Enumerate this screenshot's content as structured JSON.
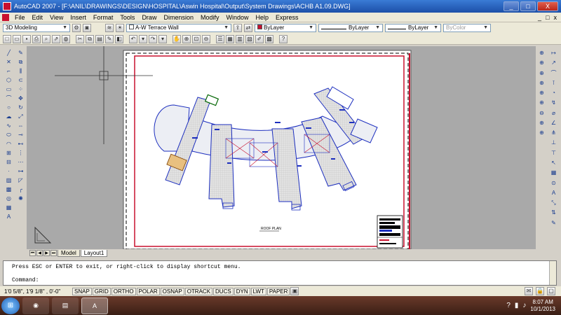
{
  "window": {
    "title": "AutoCAD 2007 - [F:\\ANIL\\DRAWINGS\\DESIGN\\HOSPITAL\\Aswin Hospital\\Output\\System Drawings\\ACHB A1.09.DWG]",
    "minimize": "_",
    "maximize": "□",
    "close": "X"
  },
  "menu": {
    "items": [
      "File",
      "Edit",
      "View",
      "Insert",
      "Format",
      "Tools",
      "Draw",
      "Dimension",
      "Modify",
      "Window",
      "Help",
      "Express"
    ],
    "doc_min": "_",
    "doc_restore": "□",
    "doc_close": "x"
  },
  "toolbar1": {
    "workspace": "3D Modeling",
    "layer": "A-W Terrace Wall",
    "color": "ByLayer",
    "linetype": "ByLayer",
    "lineweight": "ByLayer",
    "plotstyle": "ByColor"
  },
  "drawing": {
    "plan_label": "ROOF PLAN"
  },
  "tabs": {
    "model": "Model",
    "layout": "Layout1"
  },
  "command": {
    "history": "Press ESC or ENTER to exit, or right-click to display shortcut menu.",
    "prompt": "Command:"
  },
  "status": {
    "coords": "1'0 5/8\",  1'9 1/8\" , 0'-0\"",
    "buttons": [
      "SNAP",
      "GRID",
      "ORTHO",
      "POLAR",
      "OSNAP",
      "OTRACK",
      "DUCS",
      "DYN",
      "LWT",
      "PAPER"
    ]
  },
  "taskbar": {
    "time": "8:07 AM",
    "date": "10/1/2013"
  }
}
